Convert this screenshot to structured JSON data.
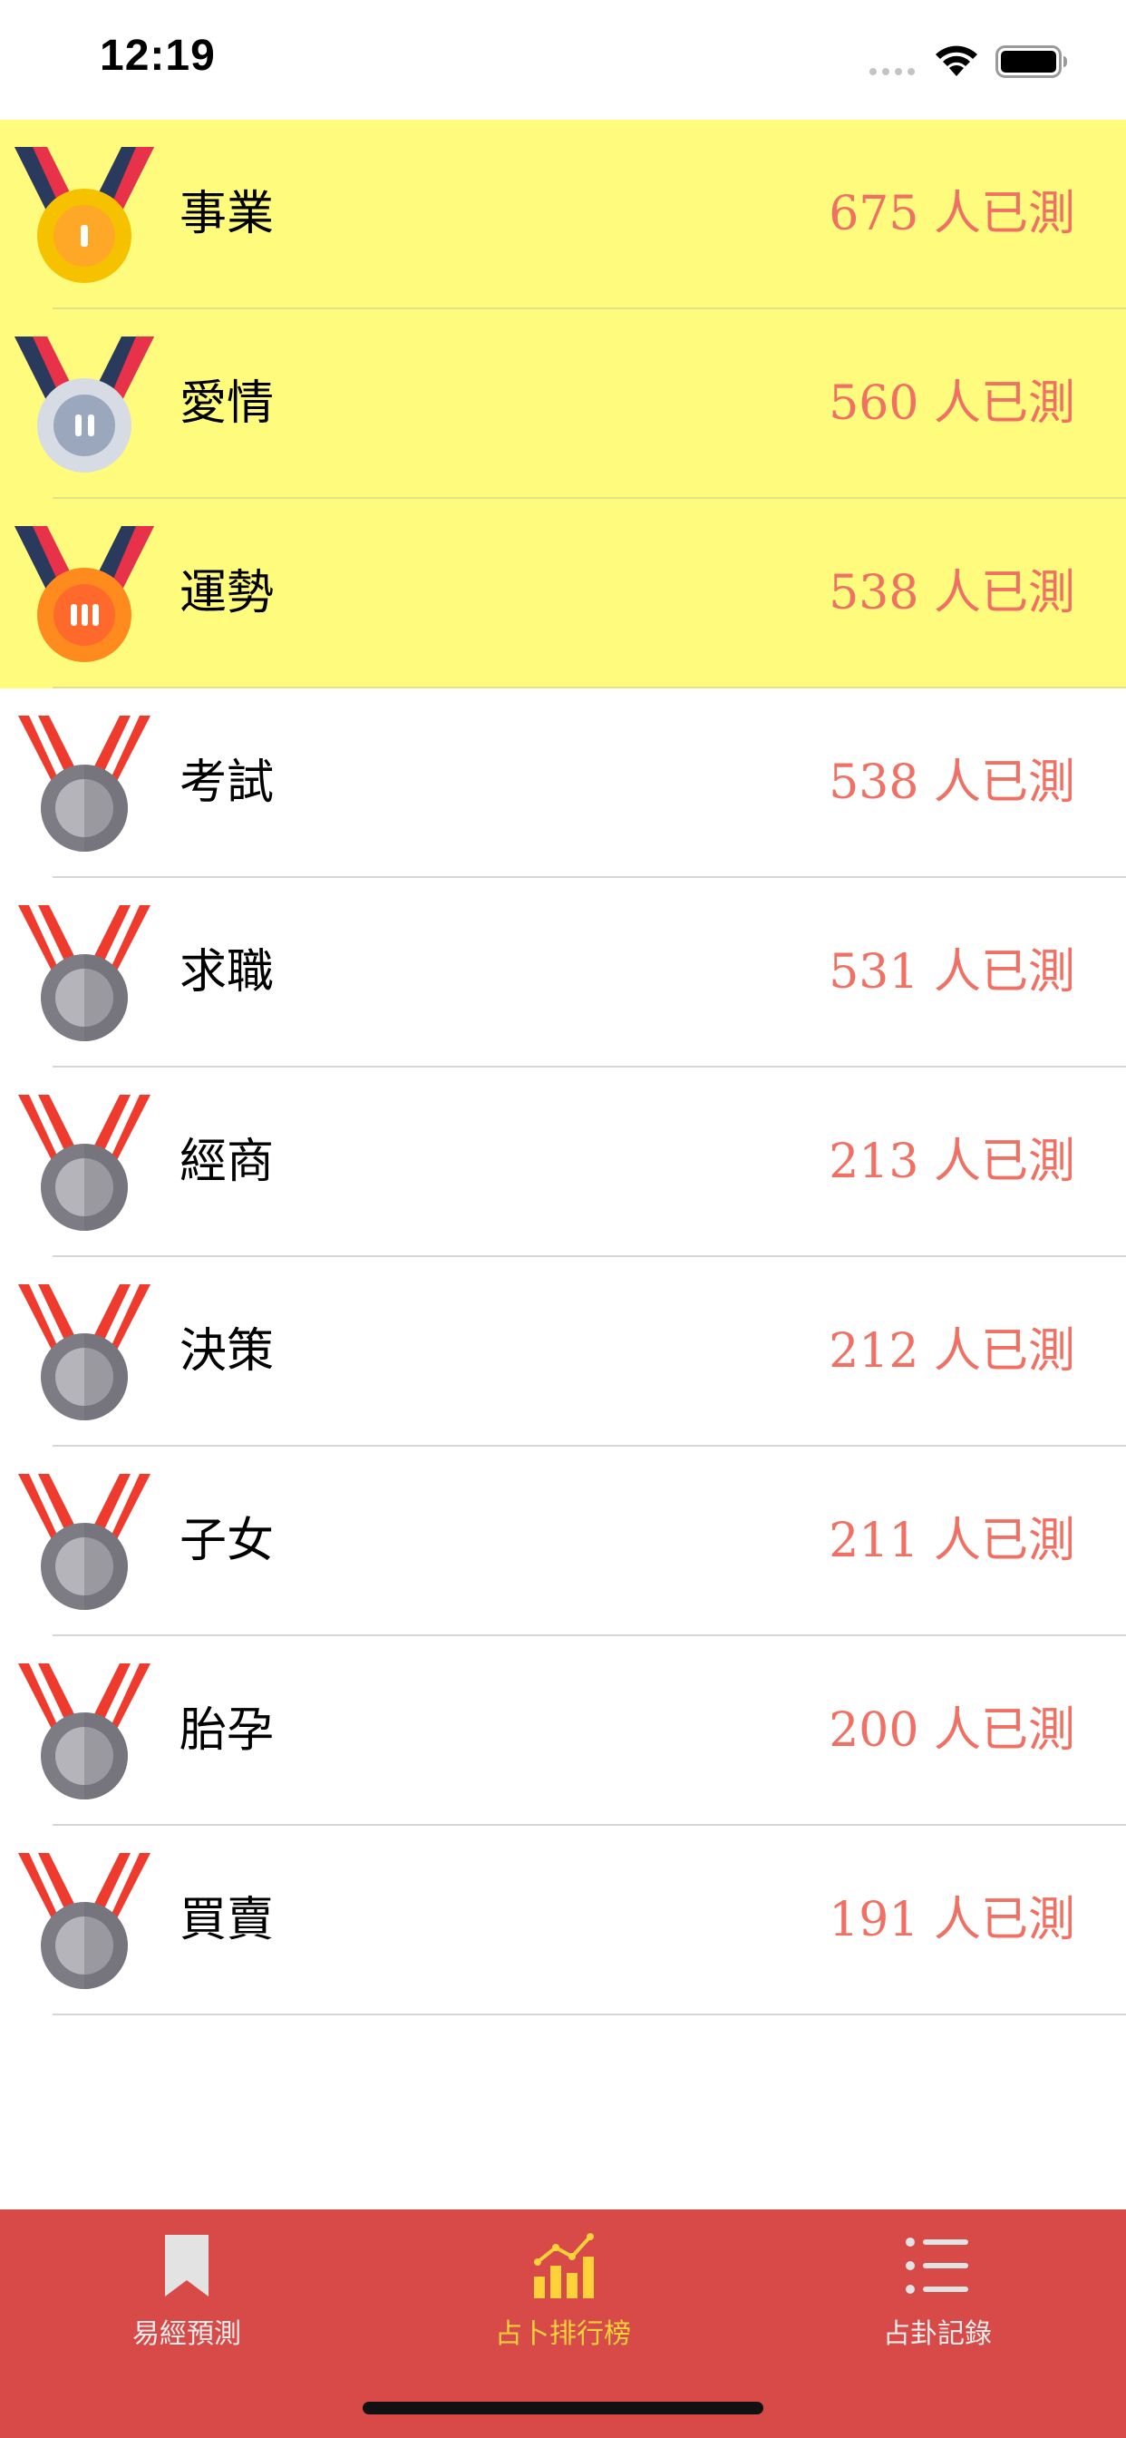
{
  "status_bar": {
    "time": "12:19"
  },
  "colors": {
    "highlight_row": "#fffb7d",
    "count_text": "#f07064",
    "tab_bar": "#d84a48",
    "tab_active": "#ffd23a",
    "tab_inactive": "#ececec"
  },
  "rankings": [
    {
      "label": "事業",
      "count": "675 人已測",
      "medal": "gold-medal-icon"
    },
    {
      "label": "愛情",
      "count": "560 人已測",
      "medal": "silver-medal-icon"
    },
    {
      "label": "運勢",
      "count": "538 人已測",
      "medal": "bronze-medal-icon"
    },
    {
      "label": "考試",
      "count": "538 人已測",
      "medal": "grey-medal-icon"
    },
    {
      "label": "求職",
      "count": "531 人已測",
      "medal": "grey-medal-icon"
    },
    {
      "label": "經商",
      "count": "213 人已測",
      "medal": "grey-medal-icon"
    },
    {
      "label": "決策",
      "count": "212 人已測",
      "medal": "grey-medal-icon"
    },
    {
      "label": "子女",
      "count": "211 人已測",
      "medal": "grey-medal-icon"
    },
    {
      "label": "胎孕",
      "count": "200 人已測",
      "medal": "grey-medal-icon"
    },
    {
      "label": "買賣",
      "count": "191 人已測",
      "medal": "grey-medal-icon"
    }
  ],
  "tabs": [
    {
      "label": "易經預測",
      "icon": "bookmark-icon",
      "active": false
    },
    {
      "label": "占卜排行榜",
      "icon": "bar-chart-icon",
      "active": true
    },
    {
      "label": "占卦記錄",
      "icon": "list-icon",
      "active": false
    }
  ]
}
